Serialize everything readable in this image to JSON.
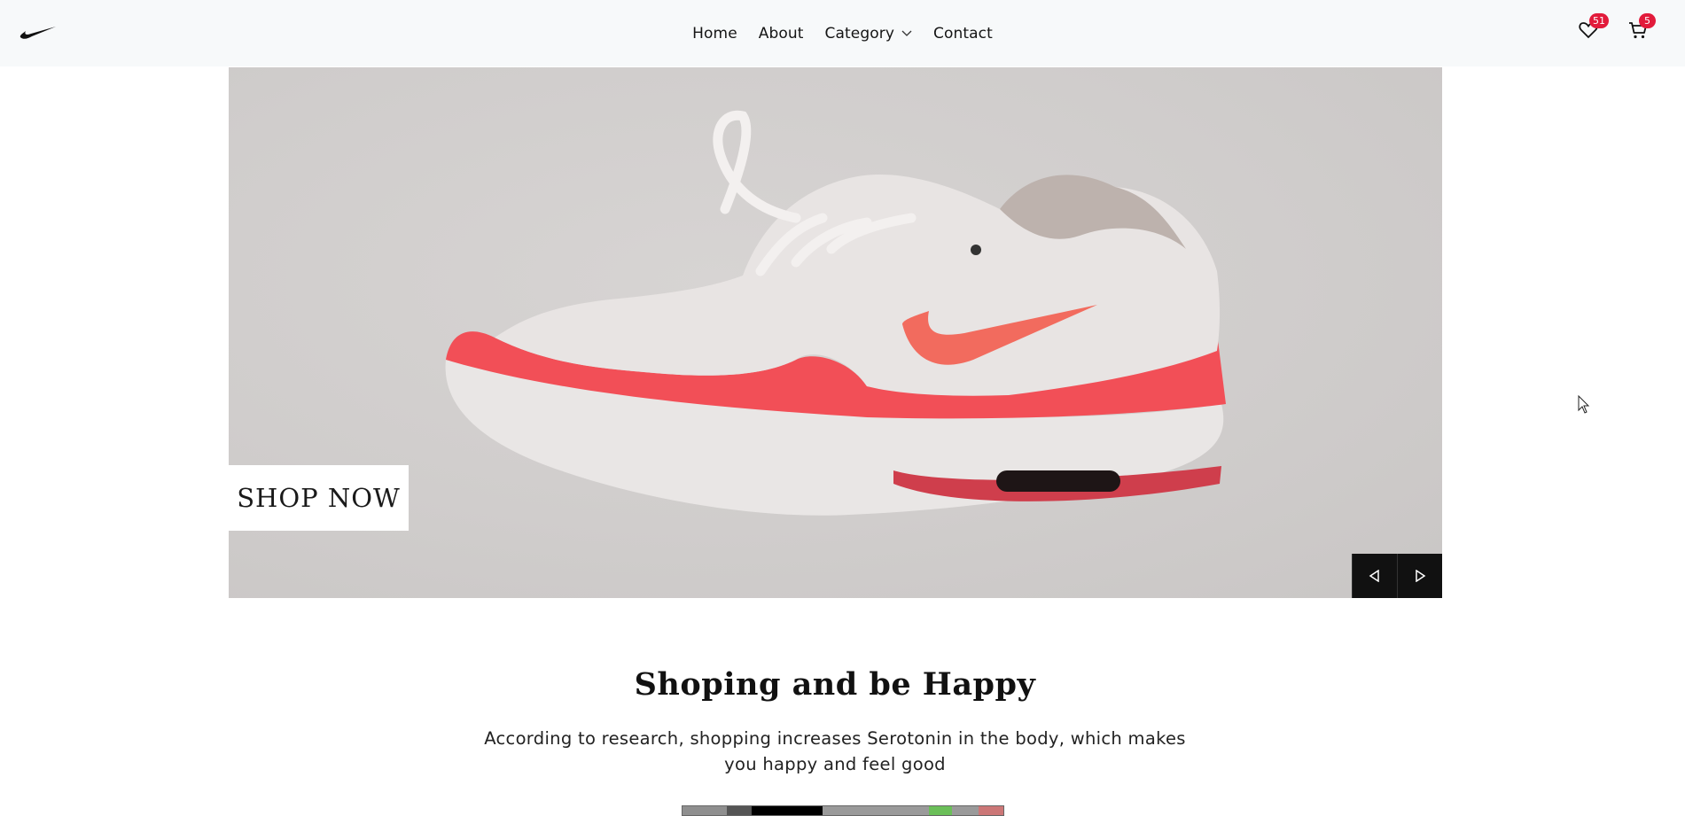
{
  "brand": {
    "logo_icon": "swoosh-icon"
  },
  "nav": {
    "links": [
      {
        "label": "Home"
      },
      {
        "label": "About"
      },
      {
        "label": "Category",
        "icon": "chevron-down-icon"
      },
      {
        "label": "Contact"
      }
    ]
  },
  "header_actions": {
    "wishlist": {
      "icon": "heart-icon",
      "count": "51"
    },
    "cart": {
      "icon": "cart-icon",
      "count": "5"
    }
  },
  "hero": {
    "image": "sneaker-photo",
    "cta_label": "SHOP NOW",
    "prev_icon": "triangle-left-icon",
    "next_icon": "triangle-right-icon"
  },
  "section": {
    "title": "Shoping and be Happy",
    "description": "According to research, shopping increases Serotonin in the body, which makes you happy and feel good"
  },
  "colors": {
    "badge": "#e21b3b",
    "navbar_bg": "#f7f9fa",
    "shoe_accent": "#f2555a"
  }
}
